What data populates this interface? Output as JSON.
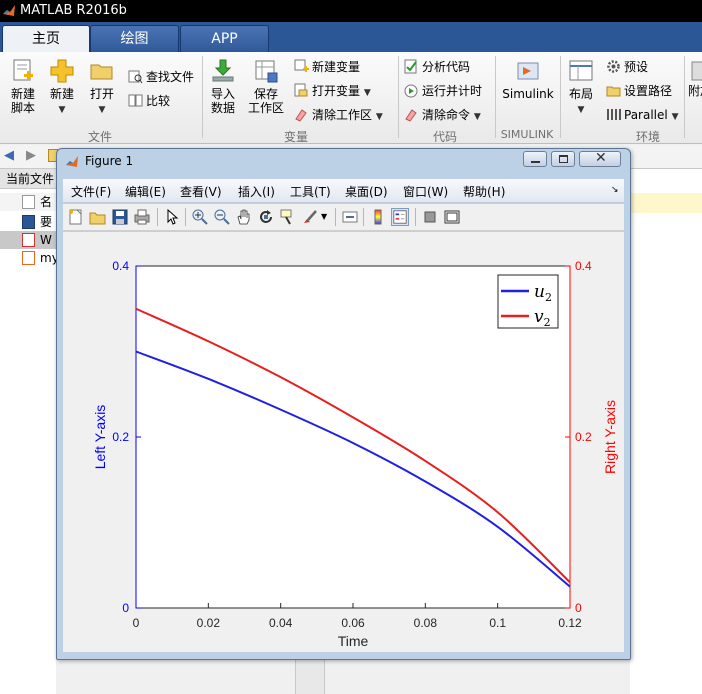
{
  "app": {
    "title": "MATLAB R2016b"
  },
  "ribbon_tabs": [
    {
      "label": "主页",
      "active": true
    },
    {
      "label": "绘图",
      "active": false
    },
    {
      "label": "APP",
      "active": false
    }
  ],
  "ribbon": {
    "file": {
      "new_script": [
        "新建",
        "脚本"
      ],
      "new": "新建",
      "open": "打开",
      "find_files": "查找文件",
      "compare": "比较",
      "group_label": "文件"
    },
    "variable": {
      "import": [
        "导入",
        "数据"
      ],
      "save_workspace": [
        "保存",
        "工作区"
      ],
      "new_variable": "新建变量",
      "open_variable": "打开变量",
      "clear_workspace": "清除工作区",
      "group_label": "变量"
    },
    "code": {
      "analyze": "分析代码",
      "run_time": "运行并计时",
      "clear_commands": "清除命令",
      "group_label": "代码"
    },
    "simulink": {
      "label": "Simulink",
      "group_label": "SIMULINK"
    },
    "env": {
      "layout": "布局",
      "preferences": "预设",
      "set_path": "设置路径",
      "parallel": "Parallel",
      "group_label": "环境"
    },
    "addons_partial": "附加"
  },
  "current_folder": {
    "label": "当前文件",
    "header_partial": "名",
    "items": [
      "要",
      "W",
      "my"
    ]
  },
  "figure": {
    "title": "Figure 1",
    "menu": [
      "文件(F)",
      "编辑(E)",
      "查看(V)",
      "插入(I)",
      "工具(T)",
      "桌面(D)",
      "窗口(W)",
      "帮助(H)"
    ],
    "toolbar_icons": [
      "new-figure-icon",
      "open-file-icon",
      "save-icon",
      "print-icon",
      "pointer-icon",
      "zoom-in-icon",
      "zoom-out-icon",
      "pan-icon",
      "rotate-icon",
      "data-cursor-icon",
      "brush-icon",
      "link-icon",
      "colorbar-icon",
      "legend-icon",
      "hide-plot-tools-icon",
      "show-plot-tools-icon"
    ]
  },
  "chart_data": {
    "type": "line",
    "xlabel": "Time",
    "ylabel_left": "Left Y-axis",
    "ylabel_right": "Right Y-axis",
    "xlim": [
      0,
      0.12
    ],
    "ylim_left": [
      0,
      0.4
    ],
    "ylim_right": [
      0,
      0.4
    ],
    "x_ticks": [
      "0",
      "0.02",
      "0.04",
      "0.06",
      "0.08",
      "0.1",
      "0.12"
    ],
    "y_ticks_left": [
      "0",
      "0.2",
      "0.4"
    ],
    "y_ticks_right": [
      "0",
      "0.2",
      "0.4"
    ],
    "legend_position": "top-right",
    "colors": {
      "left_axis": "#0000ff",
      "right_axis": "#ff0000",
      "u2": "#1f1fe6",
      "v2": "#e61f1f"
    },
    "series": [
      {
        "name": "u_2",
        "legend_main": "u",
        "legend_sub": "2",
        "axis": "left",
        "x": [
          0,
          0.02,
          0.04,
          0.06,
          0.08,
          0.1,
          0.12
        ],
        "y": [
          0.3,
          0.268,
          0.232,
          0.193,
          0.148,
          0.095,
          0.025
        ]
      },
      {
        "name": "v_2",
        "legend_main": "v",
        "legend_sub": "2",
        "axis": "right",
        "x": [
          0,
          0.02,
          0.04,
          0.06,
          0.08,
          0.1,
          0.12
        ],
        "y": [
          0.35,
          0.312,
          0.27,
          0.223,
          0.172,
          0.112,
          0.03
        ]
      }
    ]
  }
}
